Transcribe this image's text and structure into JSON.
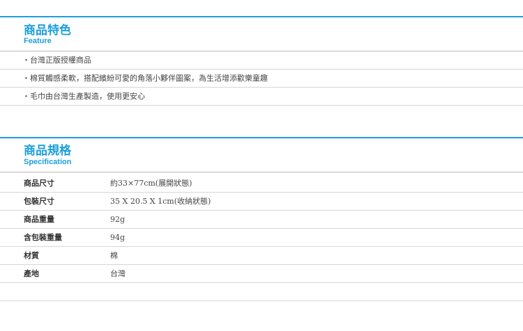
{
  "feature": {
    "title_zh": "商品特色",
    "title_en": "Feature",
    "items": [
      "・台灣正版授權商品",
      "・棉質觸感柔軟，搭配繽紛可愛的角落小夥伴圖案，為生活增添歡樂童趣",
      "・毛巾由台灣生產製造，使用更安心"
    ]
  },
  "spec": {
    "title_zh": "商品規格",
    "title_en": "Specification",
    "rows": [
      {
        "label": "商品尺寸",
        "value": "約33×77cm(展開狀態)"
      },
      {
        "label": "包裝尺寸",
        "value": "35 X 20.5 X 1cm(收納狀態)"
      },
      {
        "label": "商品重量",
        "value": "92g"
      },
      {
        "label": "含包裝重量",
        "value": "94g"
      },
      {
        "label": "材質",
        "value": "棉"
      },
      {
        "label": "產地",
        "value": "台灣"
      }
    ]
  },
  "colors": {
    "accent": "#1b9fdc",
    "rule": "#d6d6d6"
  }
}
